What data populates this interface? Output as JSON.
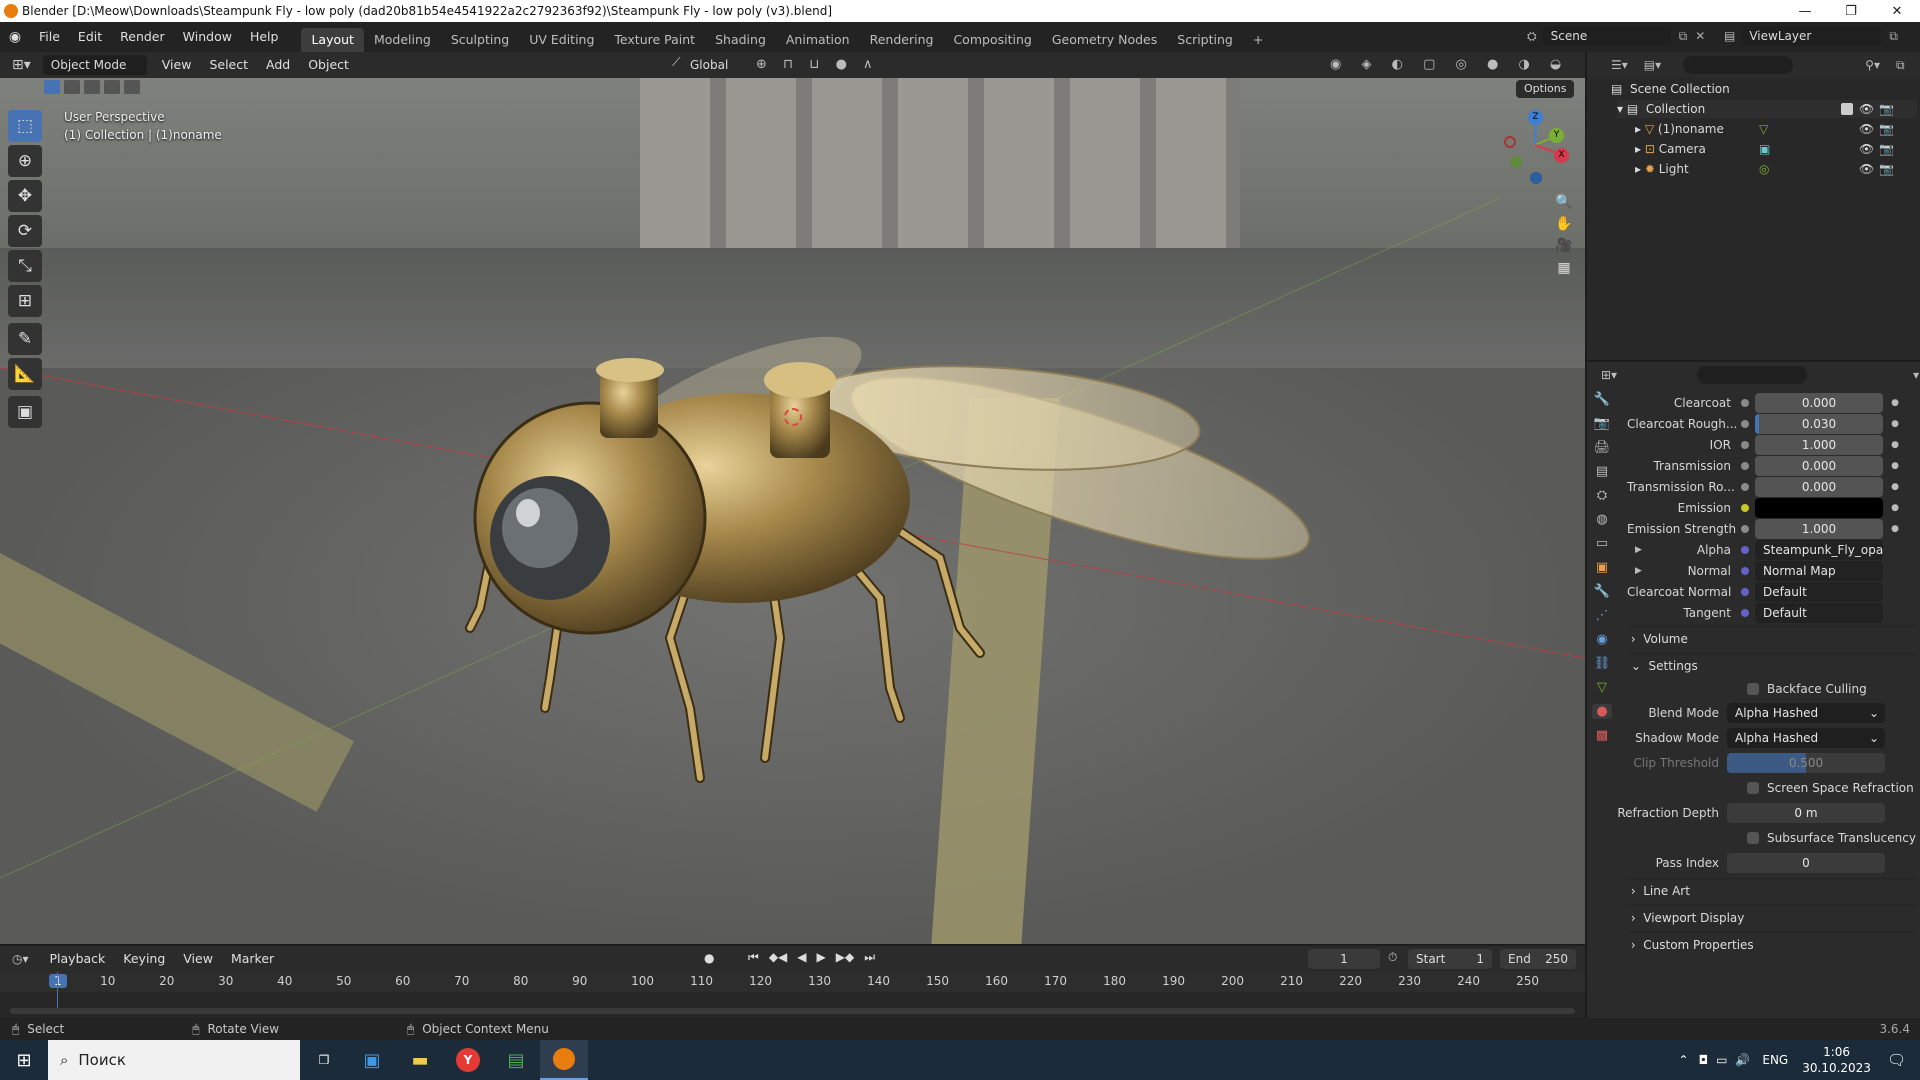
{
  "window": {
    "title": "Blender [D:\\Meow\\Downloads\\Steampunk Fly - low poly (dad20b81b54e4541922a2c2792363f92)\\Steampunk Fly - low poly (v3).blend]",
    "buttons": {
      "minimize": "—",
      "maximize": "❐",
      "close": "✕"
    }
  },
  "menubar": {
    "menus": [
      "File",
      "Edit",
      "Render",
      "Window",
      "Help"
    ],
    "workspaces": [
      "Layout",
      "Modeling",
      "Sculpting",
      "UV Editing",
      "Texture Paint",
      "Shading",
      "Animation",
      "Rendering",
      "Compositing",
      "Geometry Nodes",
      "Scripting"
    ],
    "active_workspace": "Layout",
    "add_tab": "+",
    "scene": "Scene",
    "view_layer": "ViewLayer"
  },
  "viewport_header": {
    "mode": "Object Mode",
    "menus": [
      "View",
      "Select",
      "Add",
      "Object"
    ],
    "orientation": "Global",
    "options": "Options"
  },
  "viewport": {
    "overlay_line1": "User Perspective",
    "overlay_line2": "(1) Collection | (1)noname",
    "gizmo": {
      "x": "X",
      "y": "Y",
      "z": "Z"
    }
  },
  "outliner": {
    "root": "Scene Collection",
    "collection": "Collection",
    "items": [
      {
        "label": "(1)noname",
        "icon": "mesh-object-icon"
      },
      {
        "label": "Camera",
        "icon": "camera-object-icon"
      },
      {
        "label": "Light",
        "icon": "light-object-icon"
      }
    ]
  },
  "properties": {
    "rows": [
      {
        "label": "Clearcoat",
        "value": "0.000",
        "dot": "#8a8a8a"
      },
      {
        "label": "Clearcoat Rough...",
        "value": "0.030",
        "dot": "#8a8a8a"
      },
      {
        "label": "IOR",
        "value": "1.000",
        "dot": "#8a8a8a"
      },
      {
        "label": "Transmission",
        "value": "0.000",
        "dot": "#8a8a8a"
      },
      {
        "label": "Transmission Ro...",
        "value": "0.000",
        "dot": "#8a8a8a"
      },
      {
        "label": "Emission",
        "value": "",
        "dot": "#c7c729"
      },
      {
        "label": "Emission Strength",
        "value": "1.000",
        "dot": "#8a8a8a"
      },
      {
        "label": "Alpha",
        "value": "Steampunk_Fly_opacit...",
        "dot": "#6363c7"
      },
      {
        "label": "Normal",
        "value": "Normal Map",
        "dot": "#6363c7"
      },
      {
        "label": "Clearcoat Normal",
        "value": "Default",
        "dot": "#6363c7"
      },
      {
        "label": "Tangent",
        "value": "Default",
        "dot": "#6363c7"
      }
    ],
    "panels": {
      "volume": "Volume",
      "settings": "Settings",
      "line_art": "Line Art",
      "viewport_display": "Viewport Display",
      "custom_properties": "Custom Properties"
    },
    "settings": {
      "backface_culling": "Backface Culling",
      "blend_mode_label": "Blend Mode",
      "blend_mode": "Alpha Hashed",
      "shadow_mode_label": "Shadow Mode",
      "shadow_mode": "Alpha Hashed",
      "clip_threshold_label": "Clip Threshold",
      "clip_threshold": "0.500",
      "screen_space_refraction": "Screen Space Refraction",
      "refraction_depth_label": "Refraction Depth",
      "refraction_depth": "0 m",
      "subsurface_translucency": "Subsurface Translucency",
      "pass_index_label": "Pass Index",
      "pass_index": "0"
    }
  },
  "timeline": {
    "menus": [
      "Playback",
      "Keying",
      "View",
      "Marker"
    ],
    "current_frame": "1",
    "start_label": "Start",
    "start": "1",
    "end_label": "End",
    "end": "250",
    "ticks": [
      "1",
      "10",
      "20",
      "30",
      "40",
      "50",
      "60",
      "70",
      "80",
      "90",
      "100",
      "110",
      "120",
      "130",
      "140",
      "150",
      "160",
      "170",
      "180",
      "190",
      "200",
      "210",
      "220",
      "230",
      "240",
      "250"
    ]
  },
  "statusbar": {
    "select": "Select",
    "rotate": "Rotate View",
    "context": "Object Context Menu",
    "version": "3.6.4"
  },
  "taskbar": {
    "search_placeholder": "Поиск",
    "lang": "ENG",
    "time": "1:06",
    "date": "30.10.2023"
  },
  "colors": {
    "accent": "#4772b3",
    "x_axis": "#d73a4a",
    "y_axis": "#7ab032",
    "z_axis": "#3c7fd6"
  }
}
